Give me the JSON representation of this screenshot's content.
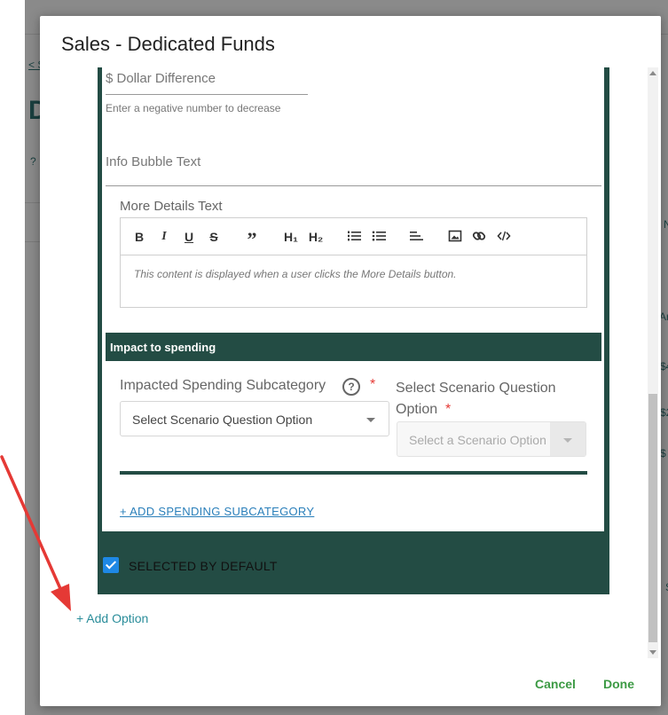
{
  "background": {
    "frag_back_link": "< S",
    "frag_heading": "D",
    "frag_help": "?",
    "frag_right_1": "N",
    "frag_right_2": "Ar",
    "frag_right_3": "$4",
    "frag_right_4": "$2",
    "frag_right_5": "$",
    "frag_right_6": "S"
  },
  "modal": {
    "title": "Sales - Dedicated Funds"
  },
  "option_card": {
    "dollar_label": "$ Dollar Difference",
    "dollar_help": "Enter a negative number to decrease",
    "info_label": "Info Bubble Text",
    "details_label": "More Details Text",
    "editor_toolbar": {
      "bold": "B",
      "italic": "I",
      "underline": "U",
      "strike": "S",
      "quote": "”",
      "h1": "H₁",
      "h2": "H₂"
    },
    "editor_placeholder": "This content is displayed when a user clicks the More Details button.",
    "impact_title": "Impact to spending",
    "subcategory_label": "Impacted Spending Subcategory",
    "help_glyph": "?",
    "required_mark": "*",
    "subcategory_select": "Select Scenario Question Option",
    "question_option_label": "Select Scenario Question Option",
    "question_option_select": "Select a Scenario Option",
    "add_subcategory": "+ ADD SPENDING SUBCATEGORY",
    "selected_by_default": "SELECTED BY DEFAULT"
  },
  "add_option": "+ Add Option",
  "footer": {
    "cancel": "Cancel",
    "done": "Done"
  },
  "colors": {
    "card_green": "#234c44",
    "action_green": "#3c9a44",
    "link_blue": "#2a7fba",
    "annotation_red": "#e53935"
  }
}
